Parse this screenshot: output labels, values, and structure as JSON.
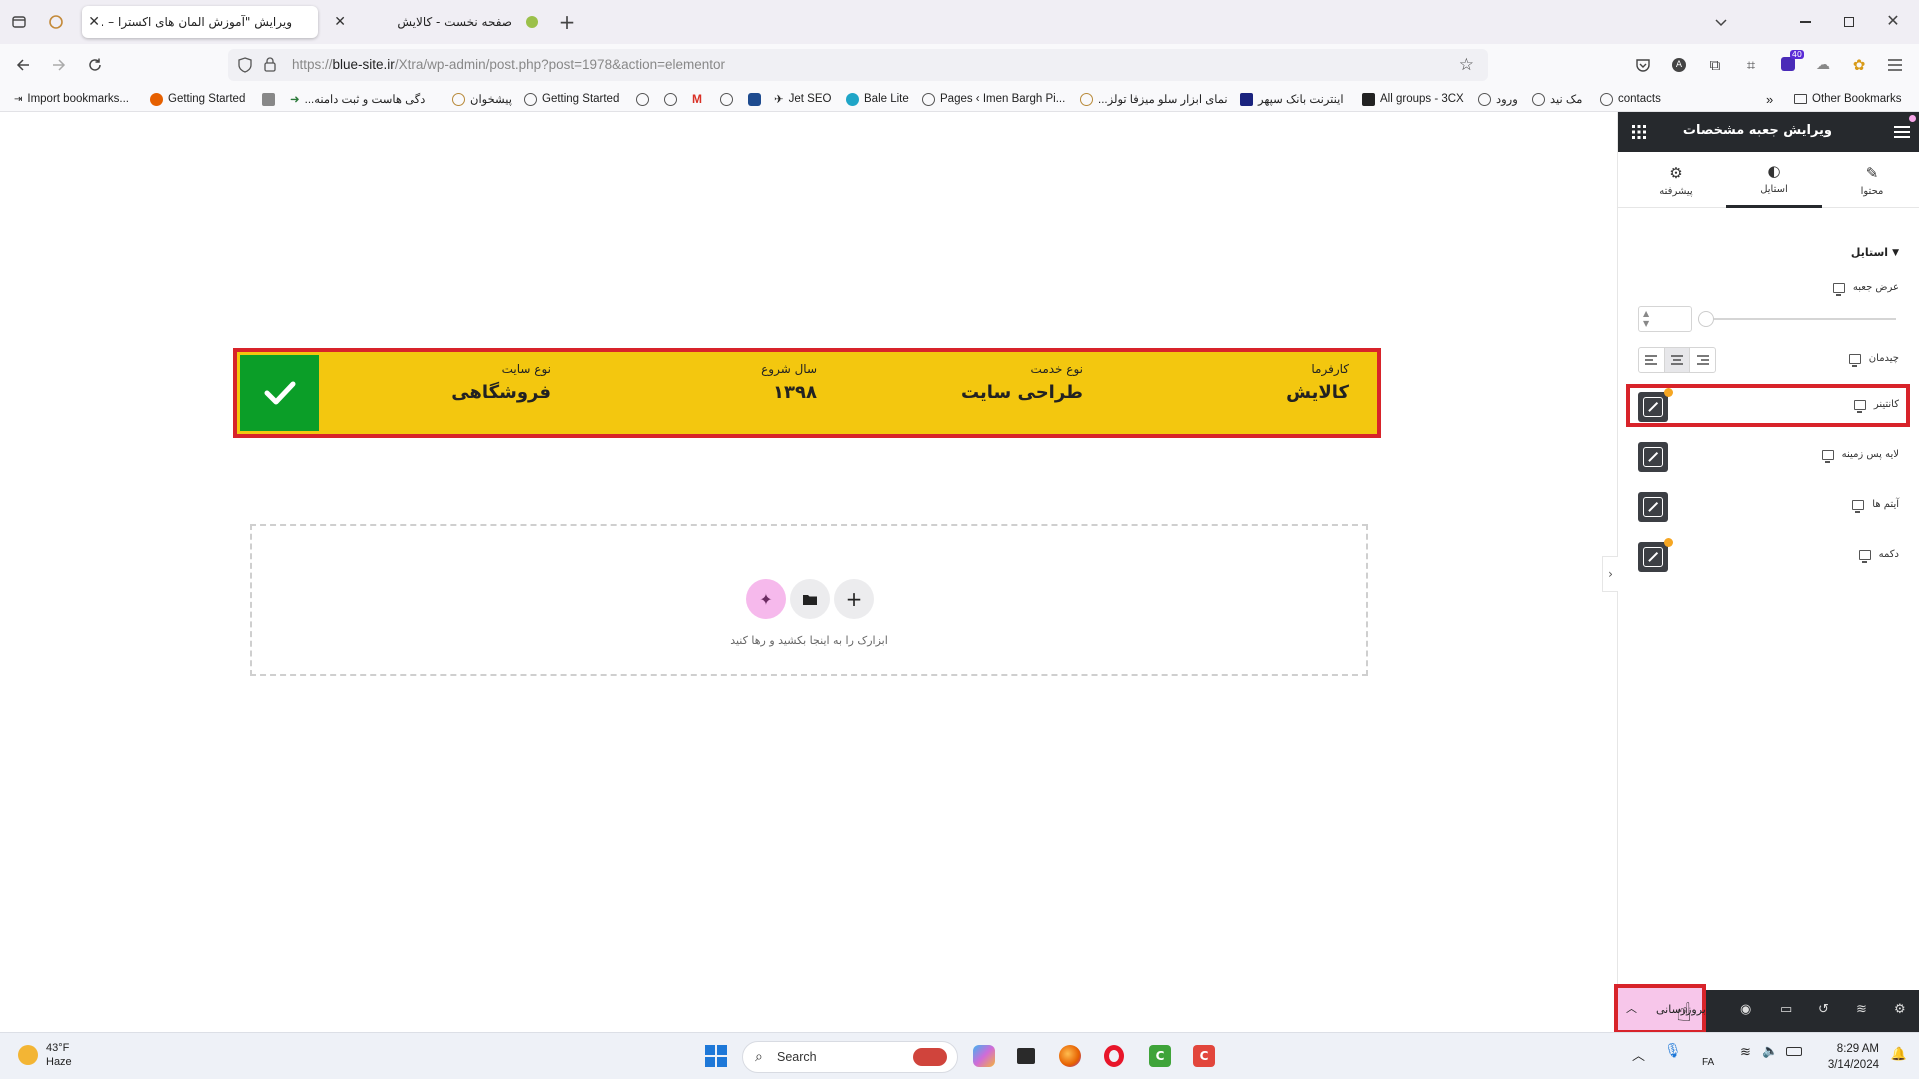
{
  "browser": {
    "tabs": [
      {
        "title": "ویرایش \"آموزش المان های اکسترا – ...\"",
        "active": true
      },
      {
        "title": "صفحه نخست - کالایش",
        "active": false
      }
    ],
    "url_prefix": "https://",
    "url_host": "blue-site.ir",
    "url_path": "/Xtra/wp-admin/post.php?post=1978&action=elementor",
    "extensions_badge": "40",
    "bookmarks": [
      "Import bookmarks...",
      "Getting Started",
      "...دگی هاست و ثبت دامنه",
      "پیشخوان",
      "Getting Started",
      "Jet SEO",
      "Bale Lite",
      "Pages ‹ Imen Bargh Pi...",
      "...نمای ابزار سلو میزفا تولز",
      "اینترنت بانک سپهر",
      "All groups - 3CX",
      "ورود",
      "مک نید",
      "contacts"
    ],
    "other_bookmarks": "Other Bookmarks"
  },
  "spec_box": {
    "items": [
      {
        "label": "کارفرما",
        "value": "کالایش"
      },
      {
        "label": "نوع خدمت",
        "value": "طراحی سایت"
      },
      {
        "label": "سال شروع",
        "value": "۱۳۹۸"
      },
      {
        "label": "نوع سایت",
        "value": "فروشگاهی"
      }
    ],
    "bg_color": "#f3c70f",
    "check_color": "#0b9e28"
  },
  "dropzone": {
    "text": "ابزارک را به اینجا بکشید و رها کنید"
  },
  "panel": {
    "title": "ویرایش جعبه مشخصات",
    "tabs": [
      {
        "label": "محتوا",
        "icon": "pencil-icon"
      },
      {
        "label": "استایل",
        "icon": "contrast-icon"
      },
      {
        "label": "پیشرفته",
        "icon": "gear-icon"
      }
    ],
    "active_tab": "استایل",
    "section": "استایل",
    "controls": {
      "box_width": "عرض جعبه",
      "alignment": "چیدمان",
      "container": "کانتینر",
      "background_layer": "لایه پس زمینه",
      "items": "آیتم ها",
      "button": "دکمه"
    },
    "publish": "بروزرسانی"
  },
  "taskbar": {
    "weather_temp": "43°F",
    "weather_desc": "Haze",
    "search_placeholder": "Search",
    "lang": "FA",
    "time": "8:29 AM",
    "date": "3/14/2024"
  }
}
